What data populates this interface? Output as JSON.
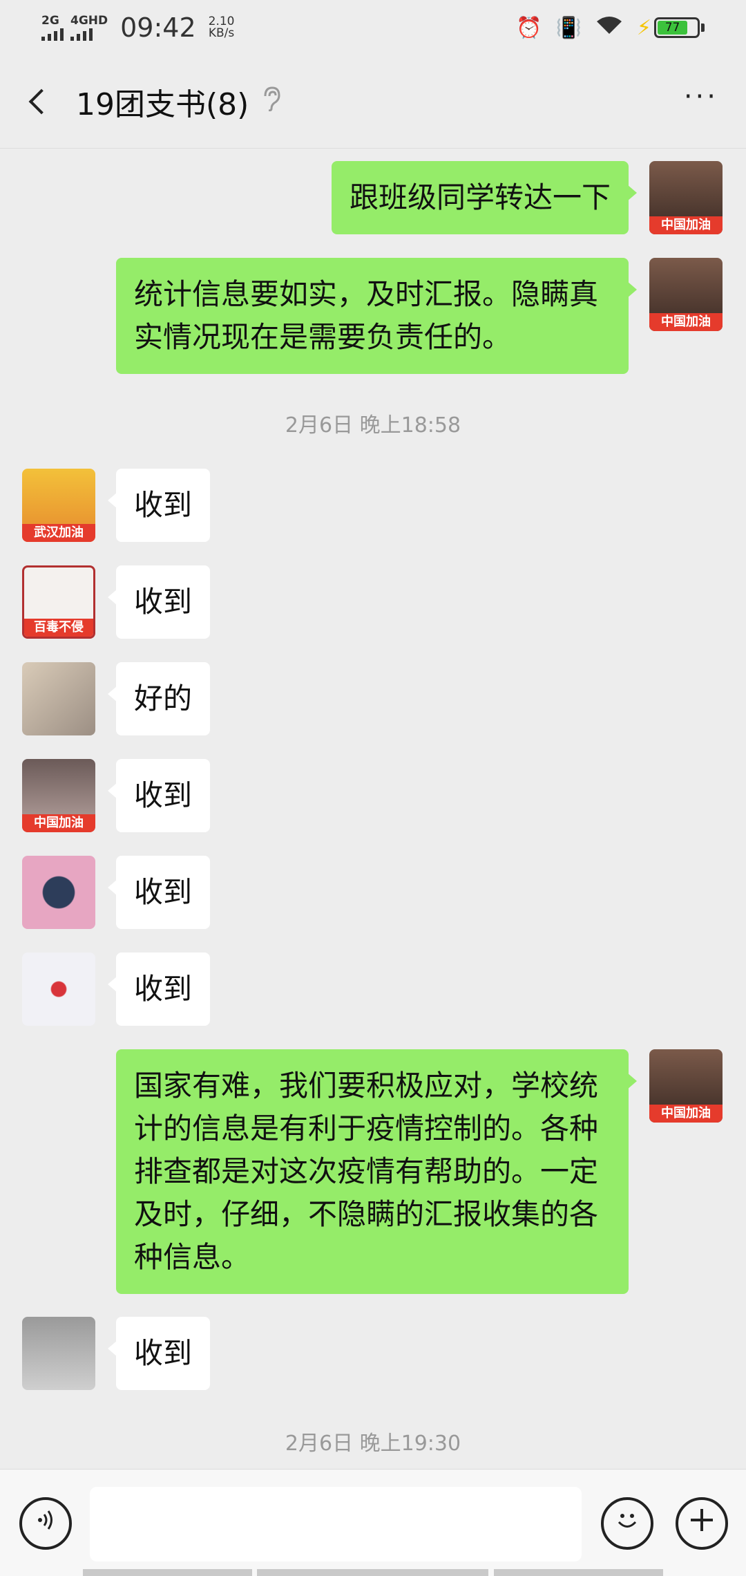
{
  "status_bar": {
    "network1": "2G",
    "network2": "4GHD",
    "time": "09:42",
    "speed_value": "2.10",
    "speed_unit": "KB/s",
    "battery": "77",
    "icons": [
      "alarm-icon",
      "vibrate-icon",
      "wifi-icon",
      "charging-icon"
    ]
  },
  "header": {
    "title": "19团支书(8)",
    "more_label": "···"
  },
  "messages": [
    {
      "side": "me",
      "text": "跟班级同学转达一下",
      "avatar_banner": "中国加油"
    },
    {
      "side": "me",
      "text": "统计信息要如实，及时汇报。隐瞒真实情况现在是需要负责任的。",
      "avatar_banner": "中国加油"
    },
    {
      "side": "them",
      "text": "收到",
      "avatar_banner": "武汉加油"
    },
    {
      "side": "them",
      "text": "收到",
      "avatar_banner": "百毒不侵"
    },
    {
      "side": "them",
      "text": "好的",
      "avatar_banner": ""
    },
    {
      "side": "them",
      "text": "收到",
      "avatar_banner": "中国加油"
    },
    {
      "side": "them",
      "text": "收到",
      "avatar_banner": ""
    },
    {
      "side": "them",
      "text": "收到",
      "avatar_banner": ""
    },
    {
      "side": "me",
      "text": "国家有难，我们要积极应对，学校统计的信息是有利于疫情控制的。各种排查都是对这次疫情有帮助的。一定及时，仔细，不隐瞒的汇报收集的各种信息。",
      "avatar_banner": "中国加油"
    },
    {
      "side": "them",
      "text": "收到",
      "avatar_banner": ""
    }
  ],
  "timestamps": [
    "2月6日 晚上18:58",
    "2月6日 晚上19:30"
  ],
  "input_bar": {
    "voice_icon": "voice-icon",
    "emoji_icon": "emoji-icon",
    "plus_icon": "plus-icon",
    "input_value": ""
  },
  "colors": {
    "my_bubble": "#95ec69",
    "their_bubble": "#ffffff",
    "background": "#ededed",
    "banner_red": "#e53b2c"
  }
}
